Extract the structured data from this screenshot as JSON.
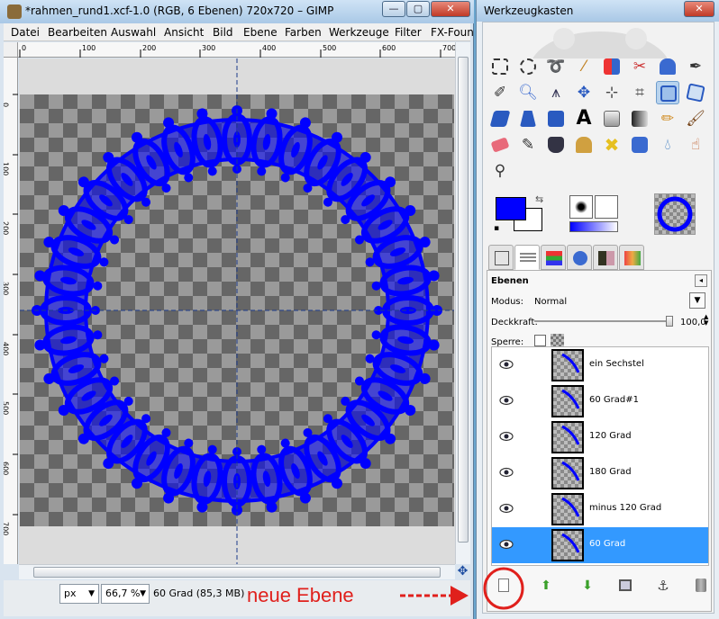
{
  "main_window": {
    "title": "*rahmen_rund1.xcf-1.0 (RGB, 6 Ebenen) 720x720 – GIMP",
    "controls": {
      "minimize": "—",
      "maximize": "▢",
      "close": "✕"
    },
    "menu": [
      "Datei",
      "Bearbeiten",
      "Auswahl",
      "Ansicht",
      "Bild",
      "Ebene",
      "Farben",
      "Werkzeuge",
      "Filter",
      "FX-Foun"
    ],
    "ruler_h": [
      "0",
      "100",
      "200",
      "300",
      "400",
      "500",
      "600",
      "700"
    ],
    "ruler_v": [
      "0",
      "100",
      "200",
      "300",
      "400",
      "500",
      "600",
      "700"
    ],
    "status": {
      "unit": "px",
      "zoom": "66,7 %",
      "layer_info": "60 Grad (85,3 MB)",
      "annotation": "neue Ebene"
    },
    "accent_color": "#0000ff"
  },
  "toolbox": {
    "title": "Werkzeugkasten",
    "controls": {
      "close": "✕"
    },
    "tools": [
      "rect-select",
      "ellipse-select",
      "lasso",
      "fuzzy-select",
      "color-select",
      "scissors",
      "foreground-select",
      "paths",
      "color-picker",
      "zoom",
      "measure",
      "move",
      "align",
      "crop",
      "rotate",
      "scale",
      "shear",
      "perspective",
      "flip",
      "text",
      "bucket-fill",
      "blend",
      "pencil",
      "paintbrush",
      "eraser",
      "airbrush",
      "ink",
      "clone",
      "heal",
      "perspective-clone",
      "blur",
      "smudge",
      "dodge-burn"
    ],
    "active_tool": "scale",
    "fg_color": "#0000ff",
    "bg_color": "#ffffff"
  },
  "layers": {
    "title": "Ebenen",
    "mode_label": "Modus:",
    "mode_value": "Normal",
    "opacity_label": "Deckkraft:",
    "opacity_value": "100,0",
    "opacity_fraction": 1.0,
    "lock_label": "Sperre:",
    "items": [
      {
        "name": "ein Sechstel",
        "selected": false
      },
      {
        "name": "60 Grad#1",
        "selected": false
      },
      {
        "name": "120 Grad",
        "selected": false
      },
      {
        "name": "180 Grad",
        "selected": false
      },
      {
        "name": "minus 120 Grad",
        "selected": false
      },
      {
        "name": "60 Grad",
        "selected": true
      }
    ]
  }
}
